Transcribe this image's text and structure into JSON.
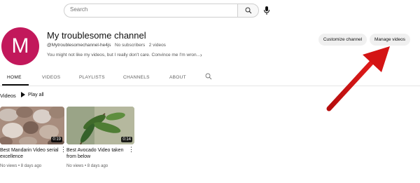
{
  "search": {
    "placeholder": "Search"
  },
  "channel": {
    "avatar_letter": "M",
    "avatar_color": "#c2185b",
    "title": "My troublesome channel",
    "handle": "@Mytroublesomechannel-he4js",
    "subscribers": "No subscribers",
    "videos_count": "2 videos",
    "description": "You might not like my videos, but I really don't care. Convince me I'm wron..."
  },
  "buttons": {
    "customize": "Customize channel",
    "manage": "Manage videos"
  },
  "tabs": [
    {
      "label": "HOME",
      "active": true
    },
    {
      "label": "VIDEOS",
      "active": false
    },
    {
      "label": "PLAYLISTS",
      "active": false
    },
    {
      "label": "CHANNELS",
      "active": false
    },
    {
      "label": "ABOUT",
      "active": false
    }
  ],
  "section": {
    "title": "Videos",
    "play_all": "Play all"
  },
  "videos": [
    {
      "title_line1": "Best Mandarin Video serial",
      "title_line2": "excellence",
      "duration": "0:19",
      "meta": "No views • 8 days ago"
    },
    {
      "title_line1": "Best Avocado Video taken",
      "title_line2": "from below",
      "duration": "0:14",
      "meta": "No views • 8 days ago"
    }
  ],
  "colors": {
    "accent_arrow": "#d01010",
    "pill_bg": "#f0f0f0"
  }
}
